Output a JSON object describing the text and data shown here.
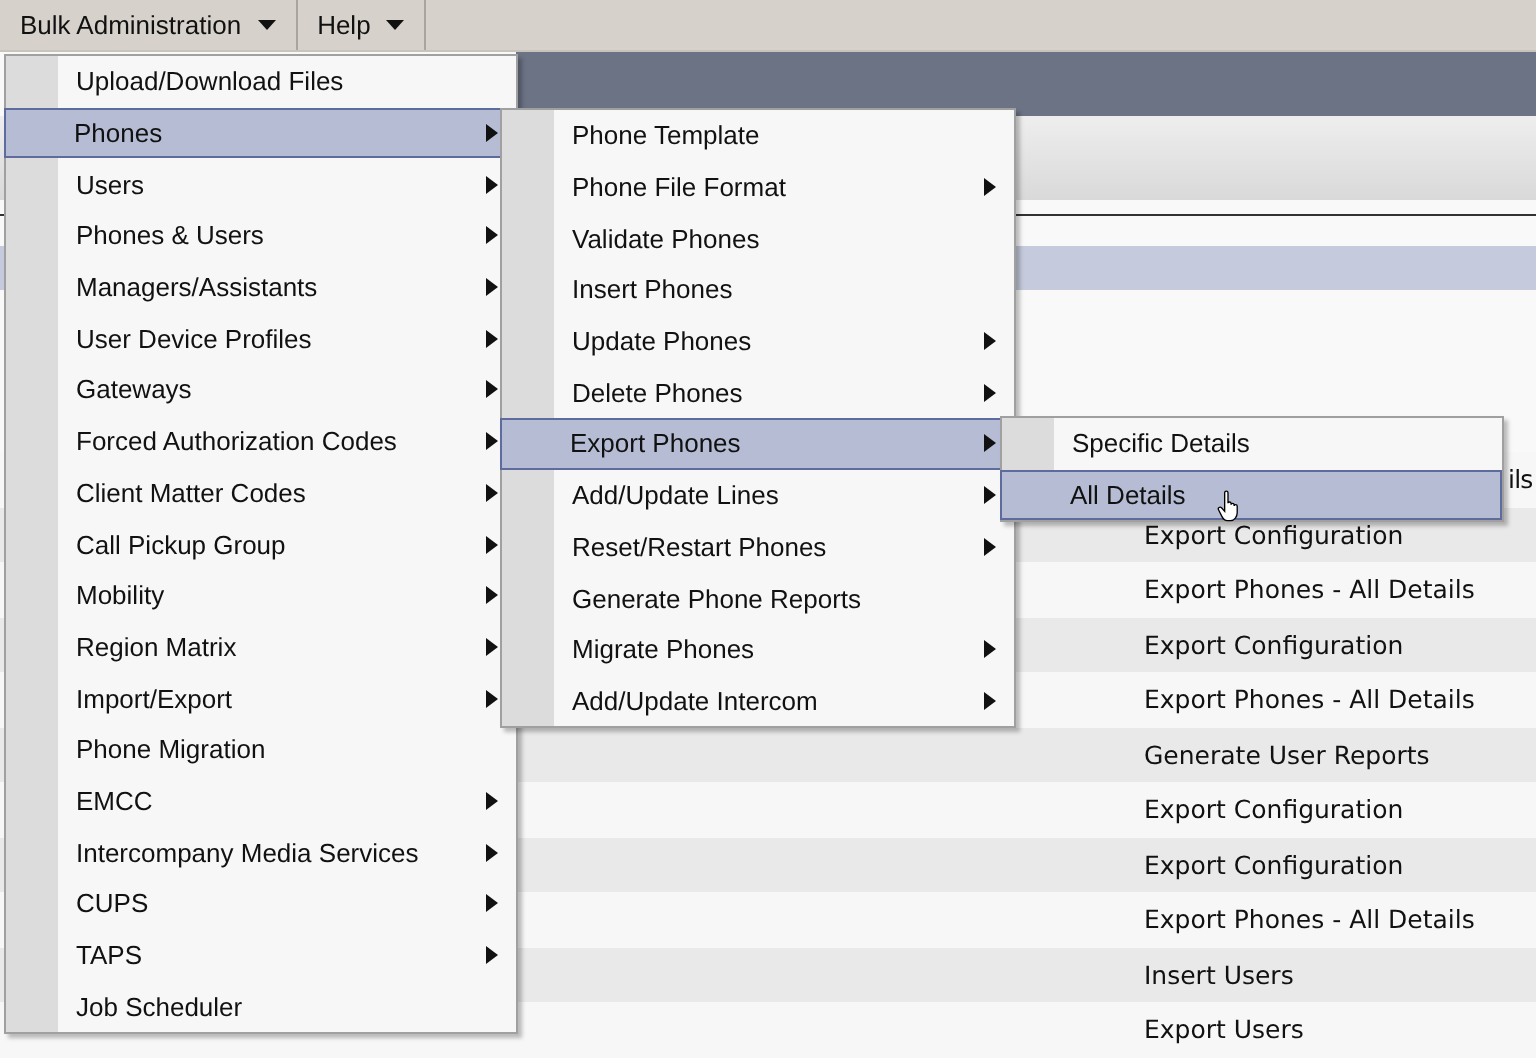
{
  "menubar": [
    {
      "label": "Bulk Administration"
    },
    {
      "label": "Help"
    }
  ],
  "menu": [
    {
      "label": "Upload/Download Files",
      "submenu": false,
      "selected": false
    },
    {
      "label": "Phones",
      "submenu": true,
      "selected": true
    },
    {
      "label": "Users",
      "submenu": true,
      "selected": false
    },
    {
      "label": "Phones & Users",
      "submenu": true,
      "selected": false
    },
    {
      "label": "Managers/Assistants",
      "submenu": true,
      "selected": false
    },
    {
      "label": "User Device Profiles",
      "submenu": true,
      "selected": false
    },
    {
      "label": "Gateways",
      "submenu": true,
      "selected": false
    },
    {
      "label": "Forced Authorization Codes",
      "submenu": true,
      "selected": false
    },
    {
      "label": "Client Matter Codes",
      "submenu": true,
      "selected": false
    },
    {
      "label": "Call Pickup Group",
      "submenu": true,
      "selected": false
    },
    {
      "label": "Mobility",
      "submenu": true,
      "selected": false
    },
    {
      "label": "Region Matrix",
      "submenu": true,
      "selected": false
    },
    {
      "label": "Import/Export",
      "submenu": true,
      "selected": false
    },
    {
      "label": "Phone Migration",
      "submenu": false,
      "selected": false
    },
    {
      "label": "EMCC",
      "submenu": true,
      "selected": false
    },
    {
      "label": "Intercompany Media Services",
      "submenu": true,
      "selected": false
    },
    {
      "label": "CUPS",
      "submenu": true,
      "selected": false
    },
    {
      "label": "TAPS",
      "submenu": true,
      "selected": false
    },
    {
      "label": "Job Scheduler",
      "submenu": false,
      "selected": false
    }
  ],
  "phones_submenu": [
    {
      "label": "Phone Template",
      "submenu": false,
      "selected": false
    },
    {
      "label": "Phone File Format",
      "submenu": true,
      "selected": false
    },
    {
      "label": "Validate Phones",
      "submenu": false,
      "selected": false
    },
    {
      "label": "Insert Phones",
      "submenu": false,
      "selected": false
    },
    {
      "label": "Update Phones",
      "submenu": true,
      "selected": false
    },
    {
      "label": "Delete Phones",
      "submenu": true,
      "selected": false
    },
    {
      "label": "Export Phones",
      "submenu": true,
      "selected": true
    },
    {
      "label": "Add/Update Lines",
      "submenu": true,
      "selected": false
    },
    {
      "label": "Reset/Restart Phones",
      "submenu": true,
      "selected": false
    },
    {
      "label": "Generate Phone Reports",
      "submenu": false,
      "selected": false
    },
    {
      "label": "Migrate Phones",
      "submenu": true,
      "selected": false
    },
    {
      "label": "Add/Update Intercom",
      "submenu": true,
      "selected": false
    }
  ],
  "export_submenu": [
    {
      "label": "Specific Details",
      "submenu": false,
      "selected": false
    },
    {
      "label": "All Details",
      "submenu": false,
      "selected": true
    }
  ],
  "table": {
    "rows": [
      {
        "kind": "cut",
        "text": "ils"
      },
      {
        "kind": "normal",
        "text": "Export Configuration"
      },
      {
        "kind": "normal",
        "text": "Export Phones - All Details"
      },
      {
        "kind": "normal",
        "text": "Export Configuration"
      },
      {
        "kind": "normal",
        "text": "Export Phones - All Details"
      },
      {
        "kind": "normal",
        "text": "Generate User Reports"
      },
      {
        "kind": "normal",
        "text": "Export Configuration"
      },
      {
        "kind": "normal",
        "text": "Export Configuration"
      },
      {
        "kind": "normal",
        "text": "Export Phones - All Details"
      },
      {
        "kind": "normal",
        "text": "Insert Users"
      },
      {
        "kind": "normal",
        "text": "Export Users"
      }
    ]
  }
}
